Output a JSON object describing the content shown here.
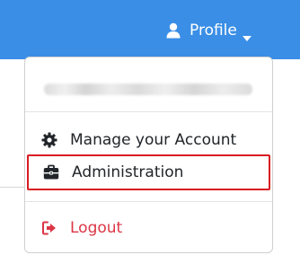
{
  "navbar": {
    "profile_label": "Profile",
    "user_icon": "user-icon",
    "caret_icon": "caret-down-icon",
    "background_color": "#3a8ee6"
  },
  "dropdown": {
    "user_name_redacted": "",
    "items": [
      {
        "label": "Manage your Account",
        "icon": "gear-icon"
      },
      {
        "label": "Administration",
        "icon": "toolbox-icon",
        "highlighted": true,
        "highlight_color": "#d81b23"
      }
    ],
    "logout": {
      "label": "Logout",
      "icon": "sign-out-icon",
      "color": "#dc3545"
    }
  }
}
